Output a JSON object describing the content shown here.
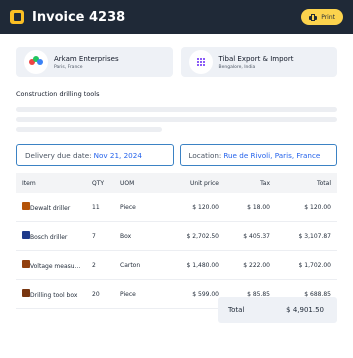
{
  "header": {
    "title": "Invoice 4238",
    "print_label": "Print"
  },
  "parties": [
    {
      "name": "Arkam Enterprises",
      "location": "Paris, France"
    },
    {
      "name": "Tibal Export & Import",
      "location": "Bengalore, India"
    }
  ],
  "description": "Construction drilling tools",
  "fields": {
    "delivery_label": "Delivery due date:",
    "delivery_value": "Nov 21, 2024",
    "location_label": "Location:",
    "location_value": "Rue de Rivoli, Paris, France"
  },
  "table": {
    "headers": {
      "item": "Item",
      "qty": "QTY",
      "uom": "UOM",
      "unit_price": "Unit price",
      "tax": "Tax",
      "total": "Total"
    },
    "rows": [
      {
        "item": "Dewalt driller",
        "qty": "11",
        "uom": "Piece",
        "unit_price": "$ 120.00",
        "tax": "$ 18.00",
        "total": "$ 120.00"
      },
      {
        "item": "Bosch driller",
        "qty": "7",
        "uom": "Box",
        "unit_price": "$ 2,702.50",
        "tax": "$ 405.37",
        "total": "$ 3,107.87"
      },
      {
        "item": "Voltage measu...",
        "qty": "2",
        "uom": "Carton",
        "unit_price": "$ 1,480.00",
        "tax": "$ 222.00",
        "total": "$ 1,702.00"
      },
      {
        "item": "Drilling tool box",
        "qty": "20",
        "uom": "Piece",
        "unit_price": "$ 599.00",
        "tax": "$ 85.85",
        "total": "$ 688.85"
      }
    ]
  },
  "total": {
    "label": "Total",
    "value": "$ 4,901.50"
  },
  "icons": [
    "invoice-icon",
    "printer-icon",
    "arkam-logo-icon",
    "tibal-logo-icon",
    "drill-icon",
    "drill-icon",
    "meter-icon",
    "toolbox-icon"
  ],
  "colors": {
    "header_bg": "#1f2937",
    "accent_yellow": "#fcd34d",
    "link_blue": "#2563eb"
  }
}
